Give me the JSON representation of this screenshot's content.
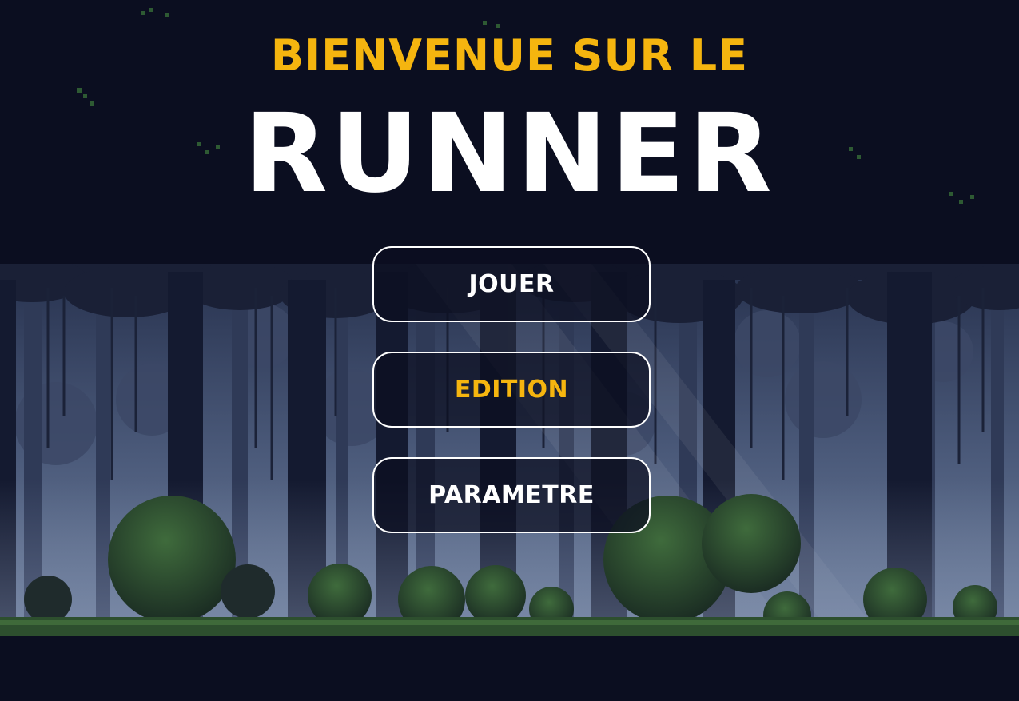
{
  "header": {
    "welcome_text": "BIENVENUE SUR LE",
    "game_title": "RUNNER"
  },
  "menu": {
    "items": [
      {
        "label": "JOUER",
        "color": "#ffffff"
      },
      {
        "label": "EDITION",
        "color": "#f5b50f"
      },
      {
        "label": "PARAMETRE",
        "color": "#ffffff"
      }
    ]
  },
  "theme": {
    "accent": "#f5b50f",
    "text": "#ffffff",
    "background": "#0b0e20"
  }
}
